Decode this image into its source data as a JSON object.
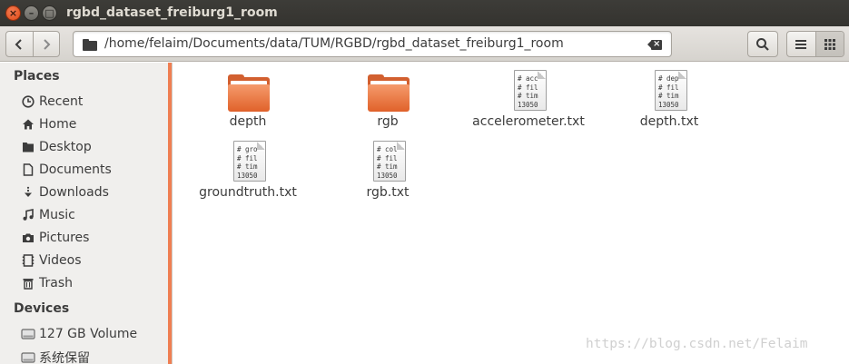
{
  "window": {
    "title": "rgbd_dataset_freiburg1_room",
    "controls": {
      "close": "×",
      "minimize": "–",
      "maximize": "□"
    }
  },
  "toolbar": {
    "back_icon": "‹",
    "forward_icon": "›",
    "path": "/home/felaim/Documents/data/TUM/RGBD/rgbd_dataset_freiburg1_room"
  },
  "sidebar": {
    "places_header": "Places",
    "places": [
      {
        "label": "Recent",
        "icon": "recent-icon"
      },
      {
        "label": "Home",
        "icon": "home-icon"
      },
      {
        "label": "Desktop",
        "icon": "desktop-icon"
      },
      {
        "label": "Documents",
        "icon": "documents-icon"
      },
      {
        "label": "Downloads",
        "icon": "downloads-icon"
      },
      {
        "label": "Music",
        "icon": "music-icon"
      },
      {
        "label": "Pictures",
        "icon": "pictures-icon"
      },
      {
        "label": "Videos",
        "icon": "videos-icon"
      },
      {
        "label": "Trash",
        "icon": "trash-icon"
      }
    ],
    "devices_header": "Devices",
    "devices": [
      {
        "label": "127 GB Volume",
        "icon": "drive-icon"
      },
      {
        "label": "系统保留",
        "icon": "drive-icon"
      }
    ]
  },
  "files": [
    {
      "name": "depth",
      "type": "folder"
    },
    {
      "name": "rgb",
      "type": "folder"
    },
    {
      "name": "accelerometer.txt",
      "type": "text",
      "preview": [
        "# acc",
        "# fil",
        "# tim",
        "13050"
      ]
    },
    {
      "name": "depth.txt",
      "type": "text",
      "preview": [
        "# dep",
        "# fil",
        "# tim",
        "13050"
      ]
    },
    {
      "name": "groundtruth.txt",
      "type": "text",
      "preview": [
        "# gro",
        "# fil",
        "# tim",
        "13050"
      ]
    },
    {
      "name": "rgb.txt",
      "type": "text",
      "preview": [
        "# col",
        "# fil",
        "# tim",
        "13050"
      ]
    }
  ],
  "watermark": "https://blog.csdn.net/Felaim",
  "colors": {
    "accent": "#ef7e52",
    "folder": "#e0612a",
    "titlebar": "#3d3c38"
  }
}
